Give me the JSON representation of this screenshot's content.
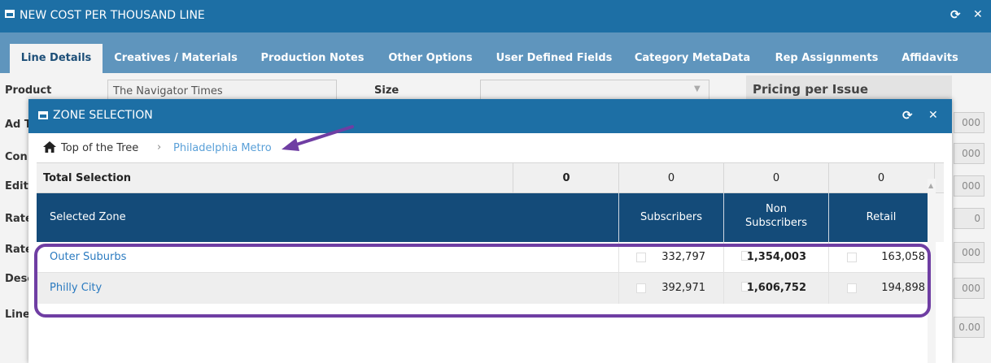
{
  "outer_window": {
    "title": "NEW COST PER THOUSAND LINE",
    "refresh_glyph": "⟳",
    "close_glyph": "✕"
  },
  "tabs": [
    {
      "label": "Line Details",
      "active": true
    },
    {
      "label": "Creatives / Materials"
    },
    {
      "label": "Production Notes"
    },
    {
      "label": "Other Options"
    },
    {
      "label": "User Defined Fields"
    },
    {
      "label": "Category MetaData"
    },
    {
      "label": "Rep Assignments"
    },
    {
      "label": "Affidavits"
    }
  ],
  "form": {
    "product_label": "Product",
    "product_value": "The Navigator Times",
    "size_label": "Size",
    "pricing_header": "Pricing per Issue",
    "partial_labels": [
      "Ad T",
      "Con",
      "Edit",
      "Rate",
      "Rate",
      "Desc",
      "Line"
    ],
    "right_values": [
      "000",
      "000",
      "000",
      "0",
      "000",
      "000",
      "0.00"
    ]
  },
  "modal": {
    "title": "ZONE SELECTION",
    "refresh_glyph": "⟳",
    "close_glyph": "✕",
    "breadcrumb": {
      "home_icon": "home-icon",
      "root": "Top of the Tree",
      "separator": "›",
      "current": "Philadelphia Metro"
    },
    "total_row": {
      "label": "Total Selection",
      "total": "0",
      "subscribers": "0",
      "non_subscribers": "0",
      "retail": "0"
    },
    "columns": {
      "zone": "Selected Zone",
      "subscribers": "Subscribers",
      "non_subscribers_line1": "Non",
      "non_subscribers_line2": "Subscribers",
      "retail": "Retail"
    },
    "rows": [
      {
        "zone": "Outer Suburbs",
        "subscribers": "332,797",
        "non_subscribers": "1,354,003",
        "retail": "163,058"
      },
      {
        "zone": "Philly City",
        "subscribers": "392,971",
        "non_subscribers": "1,606,752",
        "retail": "194,898"
      }
    ]
  },
  "annotation_color": "#6f3ea3",
  "accent_color": "#1d6fa5",
  "header_color": "#144b79"
}
